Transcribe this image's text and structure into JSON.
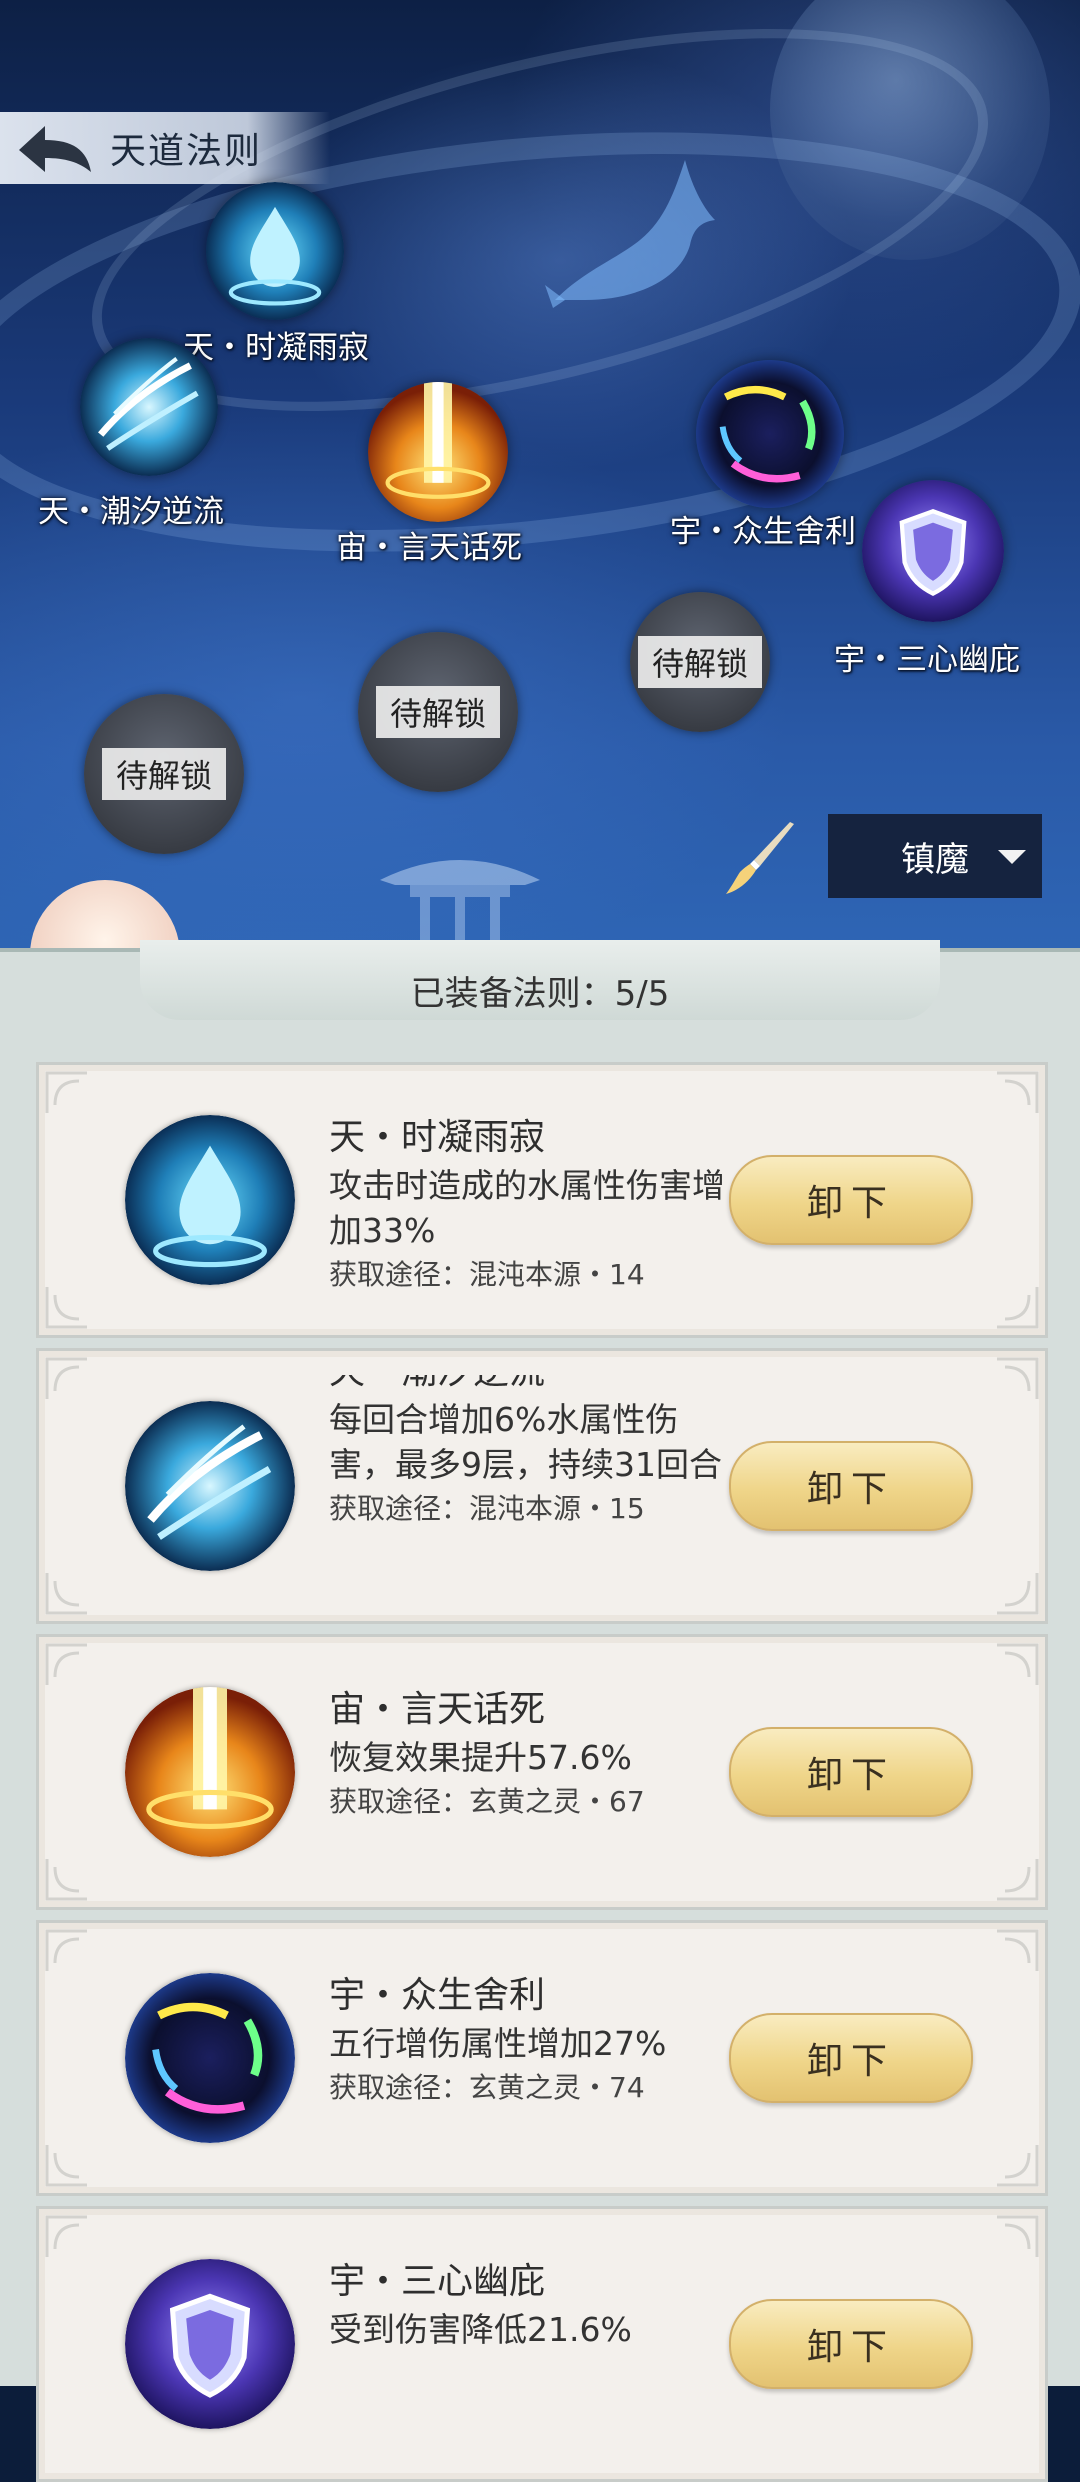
{
  "header": {
    "title": "天道法则"
  },
  "map": {
    "nodes": [
      {
        "label": "天・时凝雨寂"
      },
      {
        "label": "天・潮汐逆流"
      },
      {
        "label": "宙・言天话死"
      },
      {
        "label": "宇・众生舍利"
      },
      {
        "label": "宇・三心幽庇"
      }
    ],
    "locked": [
      "待解锁",
      "待解锁",
      "待解锁"
    ],
    "dropdown": {
      "selected": "镇魔"
    }
  },
  "panel": {
    "title": "已装备法则：5/5",
    "unequip_label": "卸下",
    "cards": [
      {
        "name": "天・时凝雨寂",
        "desc": "攻击时造成的水属性伤害增加33%",
        "source": "获取途径：混沌本源・14"
      },
      {
        "name": "天・潮汐逆流",
        "desc": "每回合增加6%水属性伤害，最多9层，持续31回合",
        "source": "获取途径：混沌本源・15"
      },
      {
        "name": "宙・言天话死",
        "desc": "恢复效果提升57.6%",
        "source": "获取途径：玄黄之灵・67"
      },
      {
        "name": "宇・众生舍利",
        "desc": "五行增伤属性增加27%",
        "source": "获取途径：玄黄之灵・74"
      },
      {
        "name": "宇・三心幽庇",
        "desc": "受到伤害降低21.6%",
        "source": ""
      }
    ]
  },
  "icons": [
    "back-arrow-icon",
    "water-drop-icon",
    "tide-swirl-icon",
    "golden-pillar-icon",
    "comet-orb-icon",
    "shield-icon",
    "brush-icon",
    "caret-down-icon"
  ]
}
